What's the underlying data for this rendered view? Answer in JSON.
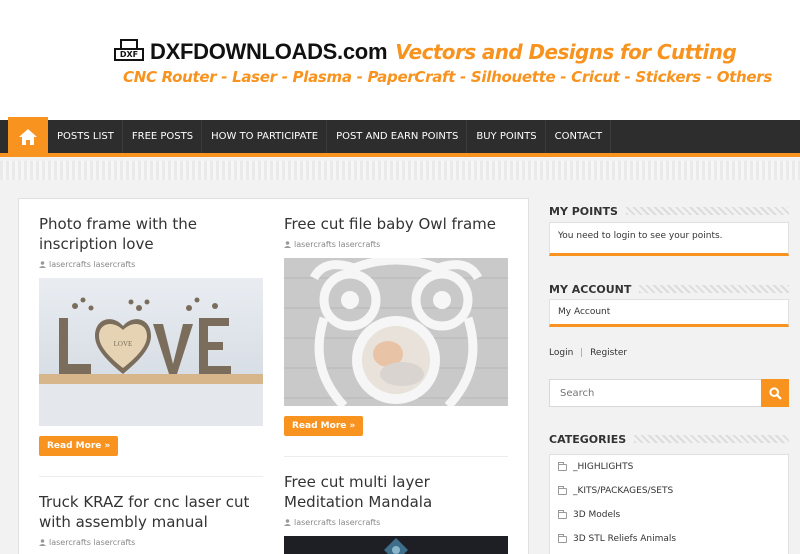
{
  "header": {
    "logo_badge": "DXF",
    "site_name": "DXFDOWNLOADS.com",
    "tagline": "Vectors and Designs for Cutting",
    "subtitle": "CNC Router - Laser - Plasma - PaperCraft - Silhouette - Cricut - Stickers - Others"
  },
  "nav": {
    "home_icon": "home-icon",
    "items": [
      "POSTS LIST",
      "FREE POSTS",
      "HOW TO PARTICIPATE",
      "POST AND EARN POINTS",
      "BUY POINTS",
      "CONTACT"
    ]
  },
  "posts": [
    {
      "title": "Photo frame with the inscription love",
      "author": "lasercrafts lasercrafts",
      "image_text": "LOVE",
      "read_more": "Read More »"
    },
    {
      "title": "Free cut file baby Owl frame",
      "author": "lasercrafts lasercrafts",
      "read_more": "Read More »"
    },
    {
      "title": "Truck KRAZ for cnc laser cut with assembly manual",
      "author": "lasercrafts lasercrafts"
    },
    {
      "title": "Free cut multi layer Meditation Mandala",
      "author": "lasercrafts lasercrafts"
    }
  ],
  "sidebar": {
    "my_points": {
      "title": "MY POINTS",
      "text": "You need to login to see your points."
    },
    "my_account": {
      "title": "MY ACCOUNT",
      "link": "My Account"
    },
    "login": "Login",
    "separator": "|",
    "register": "Register",
    "search_placeholder": "Search",
    "categories": {
      "title": "CATEGORIES",
      "items": [
        "_HIGHLIGHTS",
        "_KITS/PACKAGES/SETS",
        "3D Models",
        "3D STL Reliefs Animals"
      ]
    }
  },
  "colors": {
    "accent": "#f7931e",
    "nav_bg": "#2d2d2d",
    "text": "#333333"
  }
}
